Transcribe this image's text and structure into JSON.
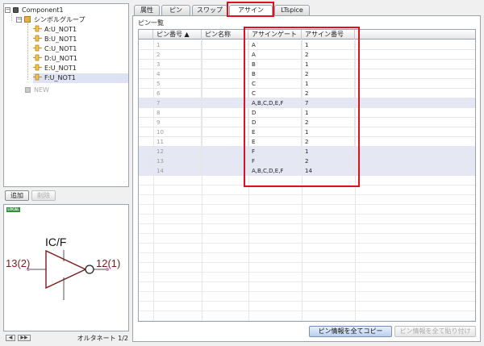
{
  "tree": {
    "expander_minus": "−",
    "items": [
      {
        "label": "Component1",
        "icon": "component-icon"
      },
      {
        "label": "シンボルグループ",
        "icon": "folder-icon"
      },
      {
        "label": "A:U_NOT1",
        "icon": "pin-icon"
      },
      {
        "label": "B:U_NOT1",
        "icon": "pin-icon"
      },
      {
        "label": "C:U_NOT1",
        "icon": "pin-icon"
      },
      {
        "label": "D:U_NOT1",
        "icon": "pin-icon"
      },
      {
        "label": "E:U_NOT1",
        "icon": "pin-icon"
      },
      {
        "label": "F:U_NOT1",
        "icon": "pin-icon",
        "selected": true
      },
      {
        "label": "NEW",
        "icon": "new-icon"
      }
    ]
  },
  "buttons": {
    "add": "追加",
    "delete": "削除",
    "copy_all": "ピン情報を全てコピー",
    "paste_all": "ピン情報を全て貼り付け"
  },
  "preview": {
    "badge": "LOCAL",
    "part_name": "IC/F",
    "input_pin": "13(2)",
    "output_pin": "12(1)",
    "nav_prev": "◀",
    "nav_next": "▶▶",
    "alt_net": "オルタネート 1/2",
    "colors": {
      "gate": "#7a1a1a",
      "pin_label": "#7a1a1a"
    }
  },
  "tabs": [
    {
      "label": "属性"
    },
    {
      "label": "ピン"
    },
    {
      "label": "スワップ"
    },
    {
      "label": "アサイン",
      "active": true
    },
    {
      "label": "LTspice"
    }
  ],
  "section_title": "ピン一覧",
  "table": {
    "headers": [
      "ピン番号 ▲",
      "ピン名称",
      "アサインゲート",
      "アサイン番号"
    ],
    "rows": [
      {
        "num": "1",
        "name": "",
        "gate": "A",
        "assign": "1"
      },
      {
        "num": "2",
        "name": "",
        "gate": "A",
        "assign": "2"
      },
      {
        "num": "3",
        "name": "",
        "gate": "B",
        "assign": "1"
      },
      {
        "num": "4",
        "name": "",
        "gate": "B",
        "assign": "2"
      },
      {
        "num": "5",
        "name": "",
        "gate": "C",
        "assign": "1"
      },
      {
        "num": "6",
        "name": "",
        "gate": "C",
        "assign": "2"
      },
      {
        "num": "7",
        "name": "",
        "gate": "A,B,C,D,E,F",
        "assign": "7"
      },
      {
        "num": "8",
        "name": "",
        "gate": "D",
        "assign": "1"
      },
      {
        "num": "9",
        "name": "",
        "gate": "D",
        "assign": "2"
      },
      {
        "num": "10",
        "name": "",
        "gate": "E",
        "assign": "1"
      },
      {
        "num": "11",
        "name": "",
        "gate": "E",
        "assign": "2"
      },
      {
        "num": "12",
        "name": "",
        "gate": "F",
        "assign": "1"
      },
      {
        "num": "13",
        "name": "",
        "gate": "F",
        "assign": "2"
      },
      {
        "num": "14",
        "name": "",
        "gate": "A,B,C,D,E,F",
        "assign": "14"
      }
    ]
  },
  "colors": {
    "highlight": "#e0101e",
    "row_highlight": "#e5e8f4"
  }
}
